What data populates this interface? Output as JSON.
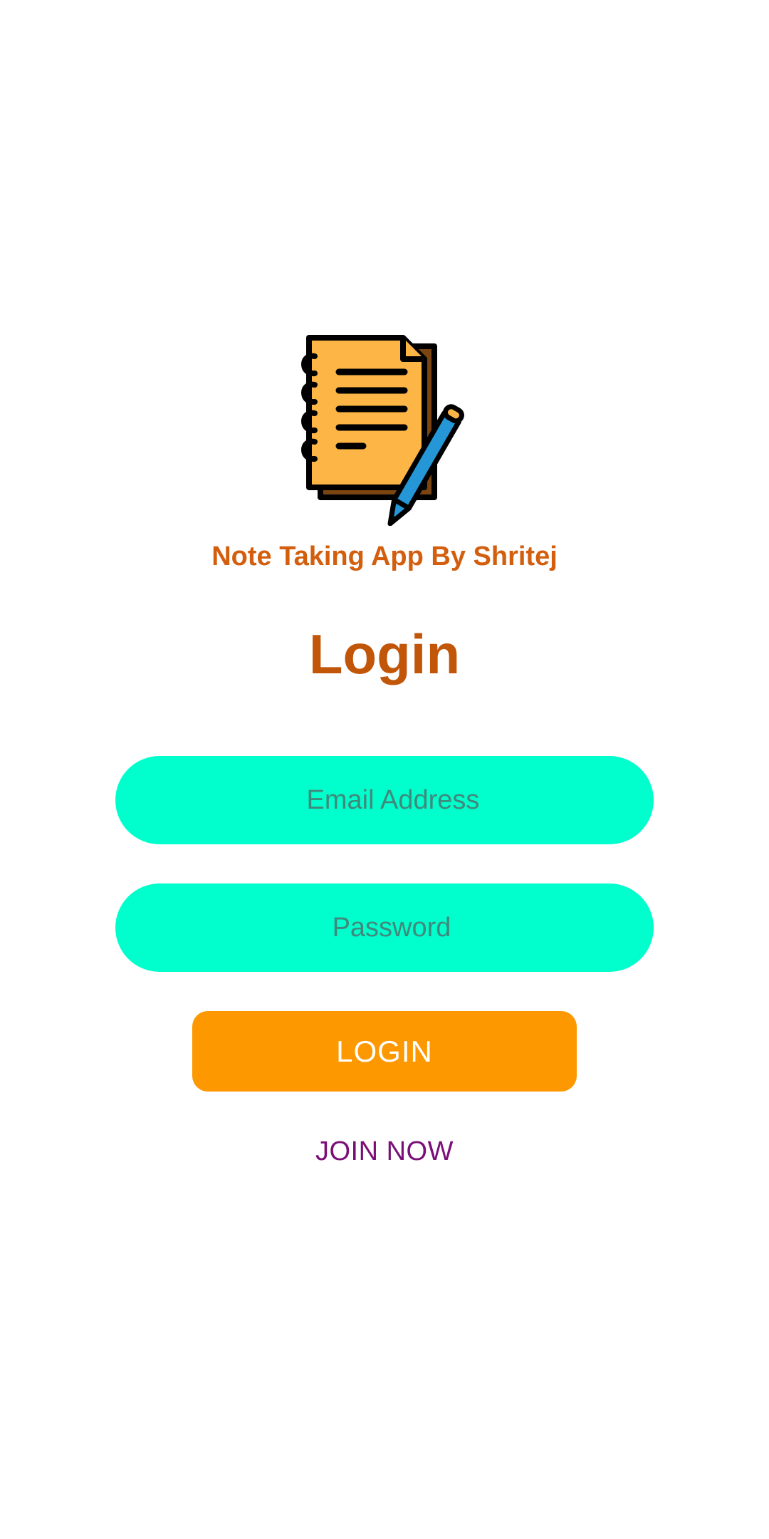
{
  "app": {
    "subtitle": "Note Taking App By Shritej",
    "logo_icon": "notebook-pencil-icon"
  },
  "login": {
    "title": "Login",
    "email_placeholder": "Email Address",
    "password_placeholder": "Password",
    "login_button_label": "LOGIN",
    "join_label": "JOIN NOW"
  },
  "colors": {
    "brand_orange": "#d35f0e",
    "title_orange": "#c15609",
    "field_background": "#00ffcc",
    "button_background": "#fd9800",
    "link_purple": "#7a0f78"
  }
}
